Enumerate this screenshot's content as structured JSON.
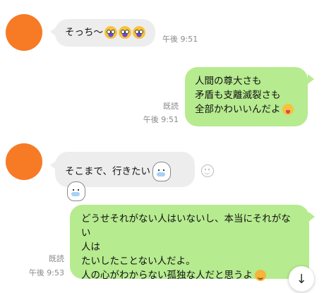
{
  "messages": [
    {
      "id": "m1",
      "side": "in",
      "text": "そっち〜",
      "emojis": [
        "scream-emoji",
        "scream-emoji",
        "scream-emoji"
      ],
      "time": "午後 9:51"
    },
    {
      "id": "m2",
      "side": "out",
      "lines": [
        "人間の尊大さも",
        "矛盾も支離滅裂さも",
        "全部かわいいんだよ"
      ],
      "emoji": "tongue-emoji",
      "read": "既読",
      "time": "午後 9:51"
    },
    {
      "id": "m3",
      "side": "in",
      "text": "そこまで、行きたい",
      "emojis": [
        "bunny-emoji",
        "bunny-emoji"
      ]
    },
    {
      "id": "m4",
      "side": "out",
      "lines": [
        "どうせそれがない人はいないし、本当にそれがない",
        "人は",
        "たいしたことない人だよ。",
        "人の心がわからない孤独な人だと思うよ"
      ],
      "emoji": "smile-emoji",
      "read": "既読",
      "time": "午後 9:53"
    }
  ],
  "colors": {
    "avatar": "#f77a25",
    "incoming_bubble": "#ededed",
    "outgoing_bubble": "#b6eb8f"
  },
  "scroll_button": {
    "icon": "arrow-down-icon",
    "glyph": "↓"
  }
}
